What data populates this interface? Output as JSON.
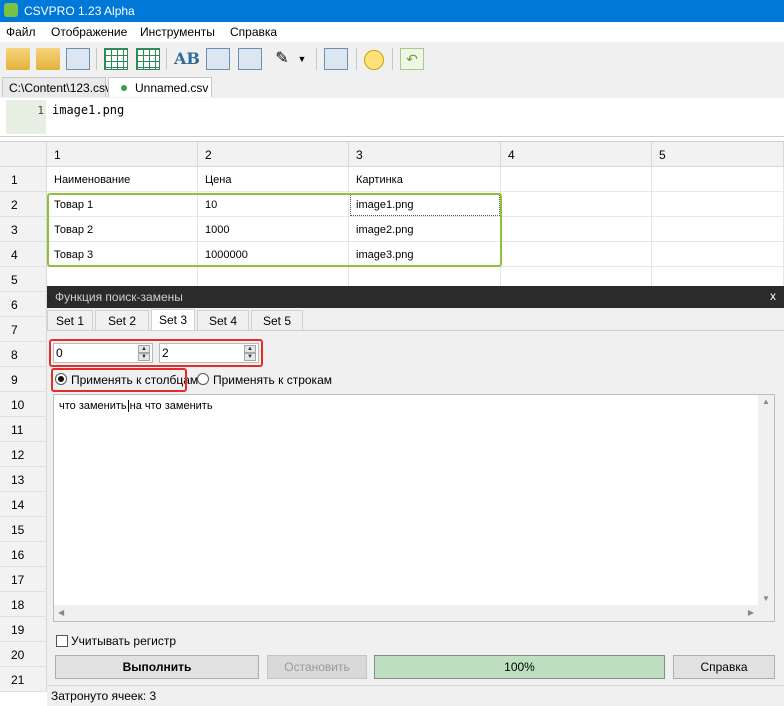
{
  "window": {
    "title": "CSVPRO 1.23 Alpha"
  },
  "menu": [
    "Файл",
    "Отображение",
    "Инструменты",
    "Справка"
  ],
  "toolbar": {
    "icons": [
      "open-folder-icon",
      "open-folder-icon",
      "print-icon",
      "table-icon",
      "table-icon",
      "text-ab-icon",
      "image-icon",
      "rows-icon",
      "magic-wand-icon",
      "dropdown-arrow-icon",
      "chart-icon",
      "lightbulb-icon",
      "undo-icon"
    ]
  },
  "tabs": [
    {
      "label": "C:\\Content\\123.csv"
    },
    {
      "label": "Unnamed.csv",
      "modified": true
    }
  ],
  "editor": {
    "line_number": "1",
    "text": "image1.png"
  },
  "grid": {
    "column_headers": [
      "1",
      "2",
      "3",
      "4",
      "5"
    ],
    "row_numbers": [
      "1",
      "2",
      "3",
      "4",
      "5",
      "6",
      "7",
      "8",
      "9",
      "10",
      "11",
      "12",
      "13",
      "14",
      "15",
      "16",
      "17",
      "18",
      "19",
      "20",
      "21"
    ],
    "rows": [
      [
        "Наименование",
        "Цена",
        "Картинка",
        "",
        ""
      ],
      [
        "Товар 1",
        "10",
        "image1.png",
        "",
        ""
      ],
      [
        "Товар 2",
        "1000",
        "image2.png",
        "",
        ""
      ],
      [
        "Товар 3",
        "1000000",
        "image3.png",
        "",
        ""
      ],
      [
        "",
        "",
        "",
        "",
        ""
      ],
      [
        "",
        "",
        "",
        "",
        ""
      ]
    ]
  },
  "dialog": {
    "title": "Функция поиск-замены",
    "close": "x",
    "sets": [
      "Set 1",
      "Set 2",
      "Set 3",
      "Set 4",
      "Set 5"
    ],
    "active_set": "Set 3",
    "from_value": "0",
    "to_value": "2",
    "radio_columns": "Применять к столбцам",
    "radio_rows": "Применять к строкам",
    "selected_mode": "columns",
    "text_before_caret": "что заменить",
    "text_after_caret": "на что заменить",
    "case_sensitive_label": "Учитывать регистр",
    "case_sensitive": false,
    "run_label": "Выполнить",
    "stop_label": "Остановить",
    "progress_text": "100%",
    "progress": 1.0,
    "help_label": "Справка",
    "status": "Затронуто ячеек: 3"
  },
  "colors": {
    "titlebar": "#0078d7",
    "highlight_green": "#8fc13e",
    "highlight_red": "#e22d2d",
    "progress_fill": "#bfe0c0",
    "dialog_titlebar": "#2b2b2b"
  }
}
